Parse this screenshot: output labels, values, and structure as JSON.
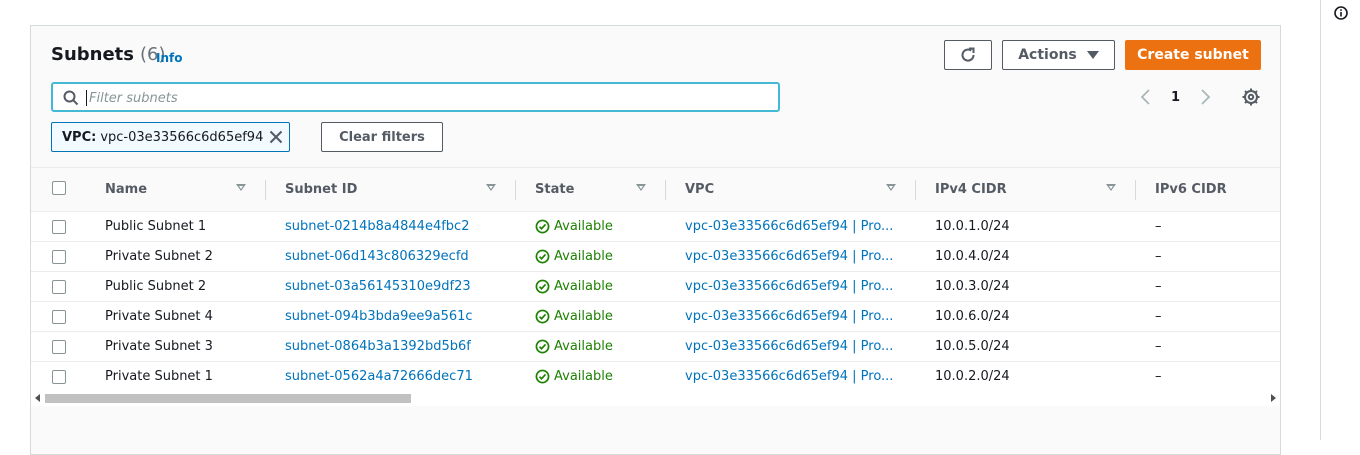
{
  "header": {
    "title": "Subnets",
    "count": "(6)",
    "info_label": "Info"
  },
  "toolbar": {
    "refresh_icon": "refresh-icon",
    "actions_label": "Actions",
    "create_label": "Create subnet",
    "accent_color": "#ec7211"
  },
  "search": {
    "placeholder": "Filter subnets",
    "value": ""
  },
  "pagination": {
    "current_page": "1"
  },
  "filter": {
    "key": "VPC:",
    "value": "vpc-03e33566c6d65ef94",
    "clear_label": "Clear filters"
  },
  "table": {
    "columns": [
      "Name",
      "Subnet ID",
      "State",
      "VPC",
      "IPv4 CIDR",
      "IPv6 CIDR"
    ],
    "rows": [
      {
        "name": "Public Subnet 1",
        "subnet_id": "subnet-0214b8a4844e4fbc2",
        "state": "Available",
        "vpc": "vpc-03e33566c6d65ef94 | Pro...",
        "ipv4": "10.0.1.0/24",
        "ipv6": "–"
      },
      {
        "name": "Private Subnet 2",
        "subnet_id": "subnet-06d143c806329ecfd",
        "state": "Available",
        "vpc": "vpc-03e33566c6d65ef94 | Pro...",
        "ipv4": "10.0.4.0/24",
        "ipv6": "–"
      },
      {
        "name": "Public Subnet 2",
        "subnet_id": "subnet-03a56145310e9df23",
        "state": "Available",
        "vpc": "vpc-03e33566c6d65ef94 | Pro...",
        "ipv4": "10.0.3.0/24",
        "ipv6": "–"
      },
      {
        "name": "Private Subnet 4",
        "subnet_id": "subnet-094b3bda9ee9a561c",
        "state": "Available",
        "vpc": "vpc-03e33566c6d65ef94 | Pro...",
        "ipv4": "10.0.6.0/24",
        "ipv6": "–"
      },
      {
        "name": "Private Subnet 3",
        "subnet_id": "subnet-0864b3a1392bd5b6f",
        "state": "Available",
        "vpc": "vpc-03e33566c6d65ef94 | Pro...",
        "ipv4": "10.0.5.0/24",
        "ipv6": "–"
      },
      {
        "name": "Private Subnet 1",
        "subnet_id": "subnet-0562a4a72666dec71",
        "state": "Available",
        "vpc": "vpc-03e33566c6d65ef94 | Pro...",
        "ipv4": "10.0.2.0/24",
        "ipv6": "–"
      }
    ]
  },
  "colors": {
    "link": "#0073bb",
    "available": "#1d8102"
  }
}
